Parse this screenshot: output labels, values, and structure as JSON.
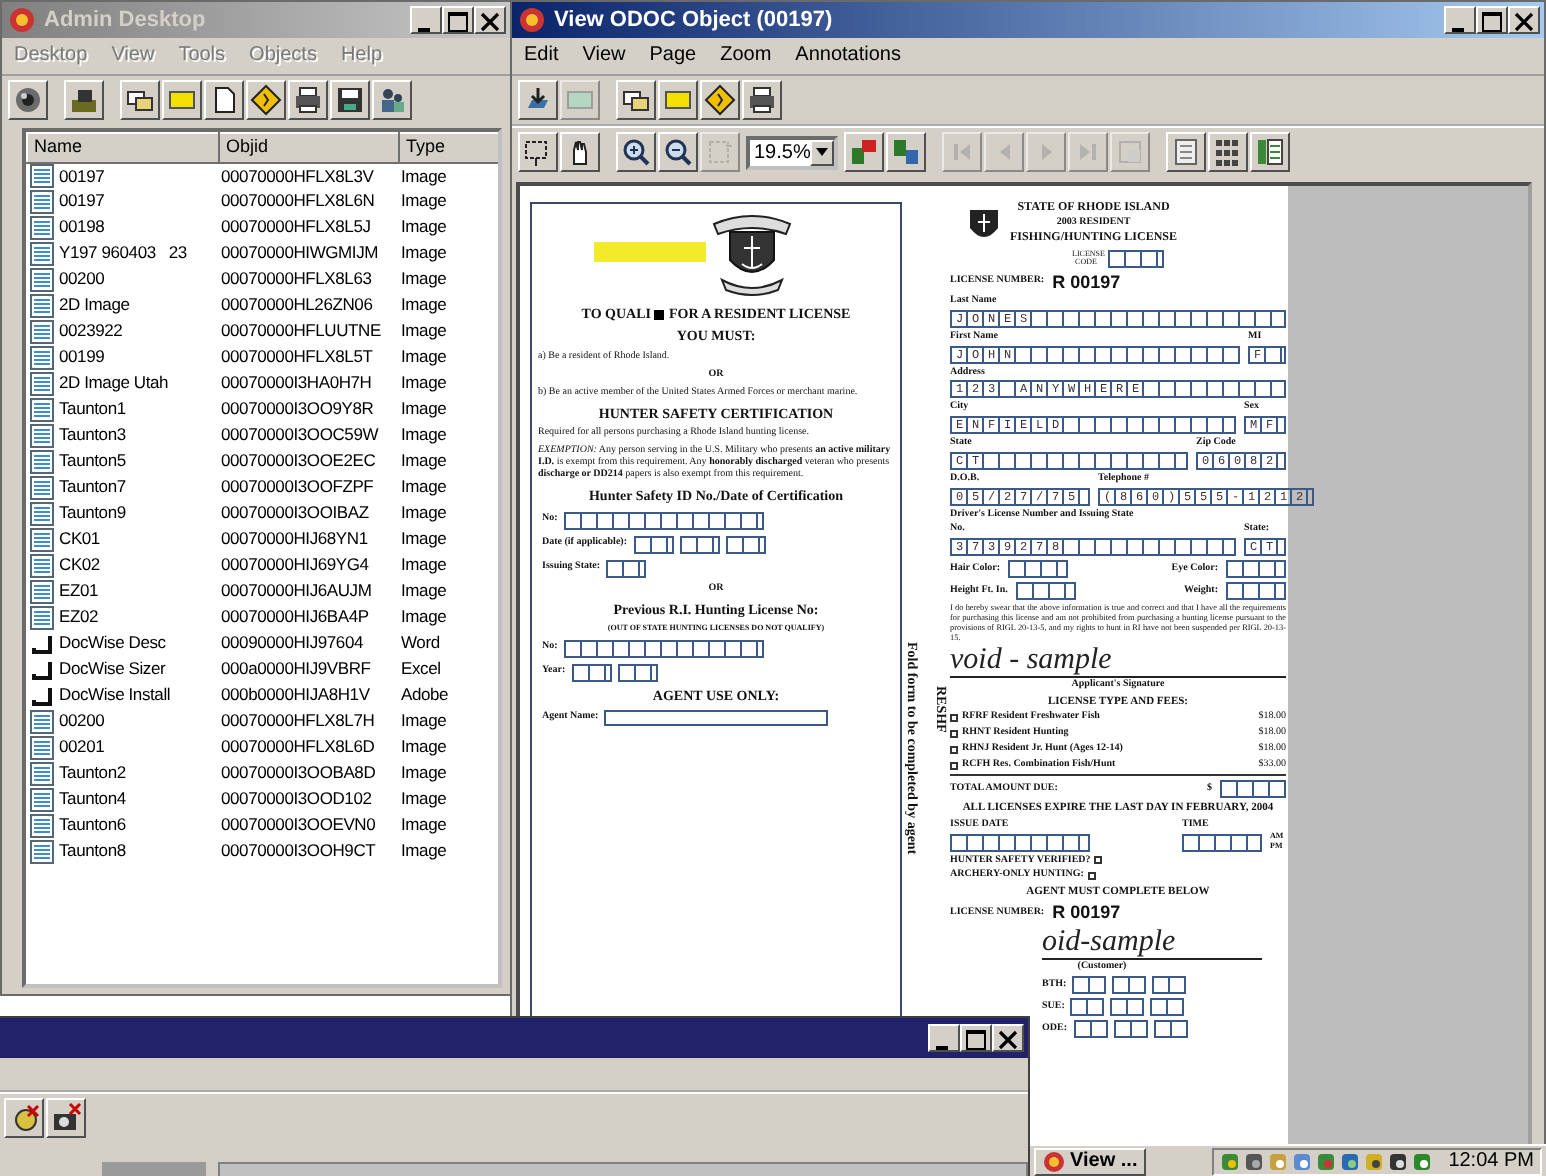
{
  "admin_window": {
    "title": "Admin Desktop",
    "active": false,
    "menu": [
      {
        "label": "Desktop",
        "disabled": true
      },
      {
        "label": "View",
        "disabled": true
      },
      {
        "label": "Tools",
        "disabled": true
      },
      {
        "label": "Objects",
        "disabled": true
      },
      {
        "label": "Help",
        "disabled": true
      }
    ],
    "table": {
      "columns": [
        "Name",
        "Objid",
        "Type"
      ],
      "rows": [
        {
          "kind": "image",
          "name": "00197",
          "objid": "00070000HFLX8L3V",
          "type": "Image"
        },
        {
          "kind": "image",
          "name": "00197",
          "objid": "00070000HFLX8L6N",
          "type": "Image"
        },
        {
          "kind": "image",
          "name": "00198",
          "objid": "00070000HFLX8L5J",
          "type": "Image"
        },
        {
          "kind": "image",
          "name": "Y197 960403   23",
          "objid": "00070000HIWGMIJM",
          "type": "Image"
        },
        {
          "kind": "image",
          "name": "00200",
          "objid": "00070000HFLX8L63",
          "type": "Image"
        },
        {
          "kind": "image",
          "name": "2D Image",
          "objid": "00070000HL26ZN06",
          "type": "Image"
        },
        {
          "kind": "image",
          "name": "0023922",
          "objid": "00070000HFLUUTNE",
          "type": "Image"
        },
        {
          "kind": "image",
          "name": "00199",
          "objid": "00070000HFLX8L5T",
          "type": "Image"
        },
        {
          "kind": "image",
          "name": "2D Image Utah",
          "objid": "00070000I3HA0H7H",
          "type": "Image"
        },
        {
          "kind": "image",
          "name": "Taunton1",
          "objid": "00070000I3OO9Y8R",
          "type": "Image"
        },
        {
          "kind": "image",
          "name": "Taunton3",
          "objid": "00070000I3OOC59W",
          "type": "Image"
        },
        {
          "kind": "image",
          "name": "Taunton5",
          "objid": "00070000I3OOE2EC",
          "type": "Image"
        },
        {
          "kind": "image",
          "name": "Taunton7",
          "objid": "00070000I3OOFZPF",
          "type": "Image"
        },
        {
          "kind": "image",
          "name": "Taunton9",
          "objid": "00070000I3OOIBAZ",
          "type": "Image"
        },
        {
          "kind": "image",
          "name": "CK01",
          "objid": "00070000HIJ68YN1",
          "type": "Image"
        },
        {
          "kind": "image",
          "name": "CK02",
          "objid": "00070000HIJ69YG4",
          "type": "Image"
        },
        {
          "kind": "image",
          "name": "EZ01",
          "objid": "00070000HIJ6AUJM",
          "type": "Image"
        },
        {
          "kind": "image",
          "name": "EZ02",
          "objid": "00070000HIJ6BA4P",
          "type": "Image"
        },
        {
          "kind": "document",
          "name": "DocWise Desc",
          "objid": "00090000HIJ97604",
          "type": "Word"
        },
        {
          "kind": "document",
          "name": "DocWise Sizer",
          "objid": "000a0000HIJ9VBRF",
          "type": "Excel"
        },
        {
          "kind": "document",
          "name": "DocWise Install",
          "objid": "000b0000HIJA8H1V",
          "type": "Adobe"
        },
        {
          "kind": "image",
          "name": "00200",
          "objid": "00070000HFLX8L7H",
          "type": "Image"
        },
        {
          "kind": "image",
          "name": "00201",
          "objid": "00070000HFLX8L6D",
          "type": "Image"
        },
        {
          "kind": "image",
          "name": "Taunton2",
          "objid": "00070000I3OOBA8D",
          "type": "Image"
        },
        {
          "kind": "image",
          "name": "Taunton4",
          "objid": "00070000I3OOD102",
          "type": "Image"
        },
        {
          "kind": "image",
          "name": "Taunton6",
          "objid": "00070000I3OOEVN0",
          "type": "Image"
        },
        {
          "kind": "image",
          "name": "Taunton8",
          "objid": "00070000I3OOH9CT",
          "type": "Image"
        }
      ]
    }
  },
  "viewer_window": {
    "title": "View ODOC Object (00197)",
    "active": true,
    "menu": [
      {
        "label": "Edit",
        "disabled": false
      },
      {
        "label": "View",
        "disabled": false
      },
      {
        "label": "Page",
        "disabled": false
      },
      {
        "label": "Zoom",
        "disabled": false
      },
      {
        "label": "Annotations",
        "disabled": false
      }
    ],
    "zoom": "19.5%",
    "document": {
      "left_panel": [
        {
          "kind": "redacted-title",
          "text": "TO QUALI",
          "rest": "FOR A RESIDENT LICENSE"
        },
        {
          "kind": "title",
          "text": "YOU MUST:"
        },
        {
          "kind": "text",
          "text": "a) Be a resident of Rhode Island."
        },
        {
          "kind": "center",
          "text": "OR"
        },
        {
          "kind": "text",
          "text": "b) Be an active member of the United States Armed Forces or merchant marine."
        },
        {
          "kind": "title",
          "text": "HUNTER SAFETY CERTIFICATION"
        },
        {
          "kind": "text",
          "text": "Required for all persons purchasing a Rhode Island hunting license."
        },
        {
          "kind": "text",
          "text": "*EXEMPTION:* Any person serving in the U.S. Military who presents **an active military I.D.** is exempt from this requirement. Any **honorably discharged** veteran who presents **discharge or DD214** papers is also exempt from this requirement."
        },
        {
          "kind": "title",
          "text": "Hunter Safety ID No./Date of Certification"
        },
        {
          "kind": "id-boxes",
          "label": "No:"
        },
        {
          "kind": "date-boxes",
          "label": "Date (if applicable):"
        },
        {
          "kind": "state-boxes",
          "label": "Issuing State:"
        },
        {
          "kind": "center",
          "text": "OR"
        },
        {
          "kind": "title",
          "text": "Previous R.I. Hunting License No:"
        },
        {
          "kind": "small",
          "text": "(OUT OF STATE HUNTING LICENSES DO NOT QUALIFY)"
        },
        {
          "kind": "id-boxes",
          "label": "No:"
        },
        {
          "kind": "year-boxes",
          "label": "Year:"
        },
        {
          "kind": "title",
          "text": "AGENT USE ONLY:"
        },
        {
          "kind": "line-field",
          "label": "Agent Name:"
        }
      ],
      "fold_note": "Fold form to be completed by agent",
      "fold_code": "RESHF",
      "right_panel": [
        {
          "kind": "header",
          "lines": [
            "STATE OF RHODE ISLAND",
            "2003 RESIDENT",
            "FISHING/HUNTING LICENSE"
          ]
        },
        {
          "kind": "code",
          "label": "LICENSE CODE"
        },
        {
          "kind": "number",
          "label": "LICENSE NUMBER:",
          "value": "R 00197"
        },
        {
          "kind": "fields",
          "fields": [
            {
              "label": "Last Name",
              "value": "JONES"
            }
          ]
        },
        {
          "kind": "fields",
          "fields": [
            {
              "label": "First Name",
              "value": "JOHN"
            },
            {
              "label": "MI",
              "value": "F"
            }
          ]
        },
        {
          "kind": "fields",
          "fields": [
            {
              "label": "Address",
              "value": "123 ANYWHERE"
            }
          ]
        },
        {
          "kind": "fields",
          "fields": [
            {
              "label": "City",
              "value": "ENFIELD"
            },
            {
              "label": "Sex",
              "value": "MF"
            }
          ]
        },
        {
          "kind": "fields",
          "fields": [
            {
              "label": "State",
              "value": "CT"
            },
            {
              "label": "Zip Code",
              "value": "06082"
            }
          ]
        },
        {
          "kind": "fields",
          "fields": [
            {
              "label": "D.O.B.",
              "value": "05/27/75"
            },
            {
              "label": "Telephone #",
              "value": "(860)555-1212"
            }
          ]
        },
        {
          "kind": "text",
          "text": "Driver's License Number and Issuing State"
        },
        {
          "kind": "fields",
          "fields": [
            {
              "label": "No.",
              "value": "3739278"
            },
            {
              "label": "State:",
              "value": "CT"
            }
          ]
        },
        {
          "kind": "inline",
          "fields": [
            {
              "label": "Hair Color:"
            },
            {
              "label": "Eye Color:"
            }
          ]
        },
        {
          "kind": "inline",
          "fields": [
            {
              "label": "Height Ft. In."
            },
            {
              "label": "Weight:"
            }
          ]
        },
        {
          "kind": "para",
          "text": "I do hereby swear that the above information is true and correct and that I have all the requirements for purchasing this license and am not prohibited from purchasing a hunting license pursuant to the provisions of RIGL 20-13-5, and my rights to hunt in RI have not been suspended per RIGL 20-13-15."
        },
        {
          "kind": "signature",
          "value": "void - sample",
          "caption": "Applicant's Signature"
        },
        {
          "kind": "title",
          "text": "LICENSE TYPE AND FEES:"
        },
        {
          "kind": "fee",
          "label": "RFRF Resident Freshwater Fish",
          "price": "$18.00",
          "checked": false
        },
        {
          "kind": "fee",
          "label": "RHNT Resident Hunting",
          "price": "$18.00",
          "checked": false
        },
        {
          "kind": "fee",
          "label": "RHNJ Resident Jr. Hunt (Ages 12-14)",
          "price": "$18.00",
          "checked": false
        },
        {
          "kind": "fee",
          "label": "RCFH Res. Combination Fish/Hunt",
          "price": "$33.00",
          "checked": false
        },
        {
          "kind": "total",
          "label": "TOTAL AMOUNT DUE:",
          "currency": "$"
        },
        {
          "kind": "title",
          "text": "ALL LICENSES EXPIRE THE LAST DAY IN FEBRUARY, 2004"
        },
        {
          "kind": "issue",
          "date_label": "ISSUE DATE",
          "time_label": "TIME",
          "ampm": "AM PM"
        },
        {
          "kind": "check",
          "label": "HUNTER SAFETY VERIFIED?",
          "checked": false
        },
        {
          "kind": "check",
          "label": "ARCHERY-ONLY HUNTING:",
          "checked": false
        },
        {
          "kind": "title",
          "text": "AGENT MUST COMPLETE BELOW"
        },
        {
          "kind": "number",
          "label": "LICENSE NUMBER:",
          "value": "R 00197"
        },
        {
          "kind": "cut-signature",
          "value": "oid-sample",
          "caption": "(Customer)"
        },
        {
          "kind": "cut-boxes",
          "label": "BTH:"
        },
        {
          "kind": "cut-boxes",
          "label": "SUE:"
        },
        {
          "kind": "cut-boxes",
          "label": "ODE:"
        }
      ]
    }
  },
  "taskbar": {
    "buttons": [
      {
        "label": "View ...",
        "selected": false
      }
    ],
    "clock": "12:04 PM"
  }
}
